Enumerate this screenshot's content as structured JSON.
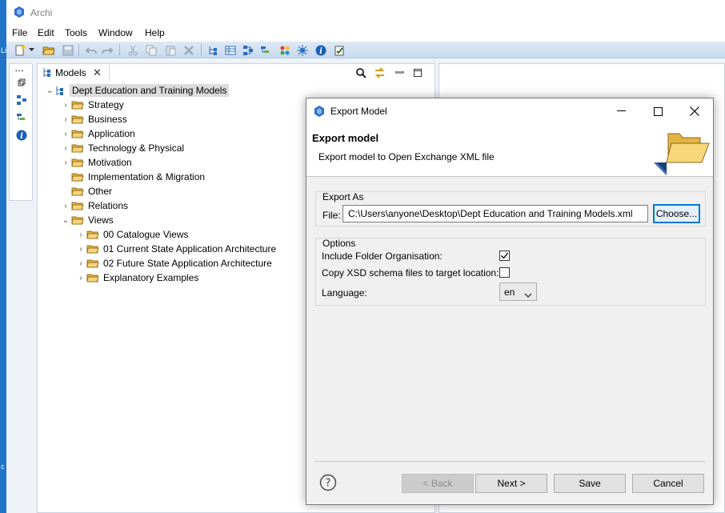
{
  "app": {
    "title": "Archi",
    "left_strip_marks": [
      "Li",
      "c"
    ]
  },
  "menu": [
    "File",
    "Edit",
    "Tools",
    "Window",
    "Help"
  ],
  "models_view": {
    "tab_label": "Models",
    "tree": [
      {
        "label": "Dept Education and Training Models",
        "level": 0,
        "expand": "open",
        "icon": "model-tree-icon",
        "selected": true
      },
      {
        "label": "Strategy",
        "level": 1,
        "expand": "closed",
        "icon": "folder-icon"
      },
      {
        "label": "Business",
        "level": 1,
        "expand": "closed",
        "icon": "folder-icon"
      },
      {
        "label": "Application",
        "level": 1,
        "expand": "closed",
        "icon": "folder-icon"
      },
      {
        "label": "Technology & Physical",
        "level": 1,
        "expand": "closed",
        "icon": "folder-icon"
      },
      {
        "label": "Motivation",
        "level": 1,
        "expand": "closed",
        "icon": "folder-icon"
      },
      {
        "label": "Implementation & Migration",
        "level": 1,
        "expand": "none",
        "icon": "folder-icon"
      },
      {
        "label": "Other",
        "level": 1,
        "expand": "none",
        "icon": "folder-icon"
      },
      {
        "label": "Relations",
        "level": 1,
        "expand": "closed",
        "icon": "folder-icon"
      },
      {
        "label": "Views",
        "level": 1,
        "expand": "open",
        "icon": "folder-icon"
      },
      {
        "label": "00 Catalogue Views",
        "level": 2,
        "expand": "closed",
        "icon": "folder-icon"
      },
      {
        "label": "01 Current State Application Architecture",
        "level": 2,
        "expand": "closed",
        "icon": "folder-icon"
      },
      {
        "label": "02 Future State Application Architecture",
        "level": 2,
        "expand": "closed",
        "icon": "folder-icon"
      },
      {
        "label": "Explanatory Examples",
        "level": 2,
        "expand": "closed",
        "icon": "folder-icon"
      }
    ]
  },
  "dialog": {
    "title": "Export Model",
    "header_title": "Export model",
    "header_desc": "Export model to Open Exchange XML file",
    "export_as": {
      "group_label": "Export As",
      "file_label": "File:",
      "file_value": "C:\\Users\\anyone\\Desktop\\Dept Education and Training Models.xml",
      "choose_label": "Choose..."
    },
    "options": {
      "group_label": "Options",
      "include_folder_label": "Include Folder Organisation:",
      "include_folder_checked": true,
      "copy_xsd_label": "Copy XSD schema files to target location:",
      "copy_xsd_checked": false,
      "language_label": "Language:",
      "language_value": "en"
    },
    "buttons": {
      "back": "< Back",
      "next": "Next >",
      "save": "Save",
      "cancel": "Cancel"
    }
  },
  "colors": {
    "accent": "#0078d7",
    "left_strip": "#1f74c8",
    "folder": "#f3c45a",
    "selected_row": "#dcdcdc"
  }
}
